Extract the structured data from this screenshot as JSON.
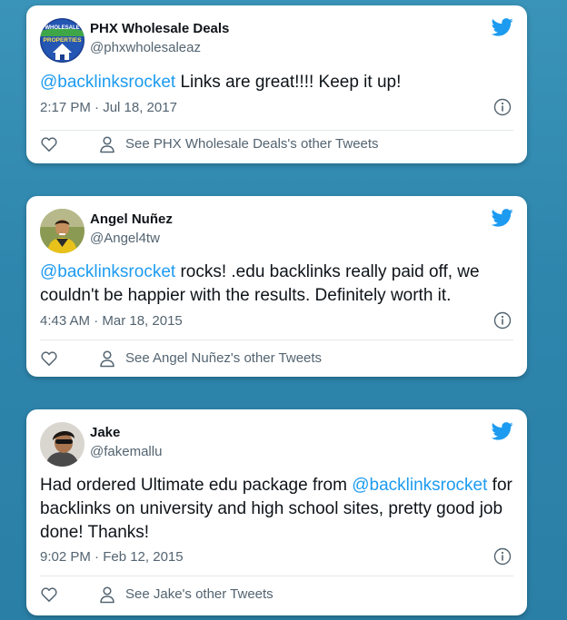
{
  "colors": {
    "background": "#2e86ad",
    "card": "#ffffff",
    "mention": "#1d9bf0",
    "twitter_blue": "#1d9bf0",
    "muted_text": "#536471",
    "primary_text": "#0f1419"
  },
  "tweets": [
    {
      "author_name": "PHX Wholesale Deals",
      "handle": "@phxwholesaleaz",
      "avatar_text": [
        "WHOLESALE",
        "PROPERTIES"
      ],
      "text_parts": [
        {
          "text": "@backlinksrocket",
          "mention": true
        },
        {
          "text": " Links are great!!!! Keep it up!",
          "mention": false
        }
      ],
      "timestamp": "2:17 PM · Jul 18, 2017",
      "see_tweets_label": "See PHX Wholesale Deals's other Tweets",
      "icons": [
        "twitter-bird-icon",
        "info-icon",
        "heart-icon",
        "person-icon"
      ]
    },
    {
      "author_name": "Angel Nuñez",
      "handle": "@Angel4tw",
      "text_parts": [
        {
          "text": "@backlinksrocket",
          "mention": true
        },
        {
          "text": " rocks! .edu backlinks really paid off, we couldn't be happier with the results. Definitely worth it.",
          "mention": false
        }
      ],
      "timestamp": "4:43 AM · Mar 18, 2015",
      "see_tweets_label": "See Angel Nuñez's other Tweets",
      "icons": [
        "twitter-bird-icon",
        "info-icon",
        "heart-icon",
        "person-icon"
      ]
    },
    {
      "author_name": "Jake",
      "handle": "@fakemallu",
      "text_parts": [
        {
          "text": "Had ordered Ultimate edu package from ",
          "mention": false
        },
        {
          "text": "@backlinksrocket",
          "mention": true
        },
        {
          "text": " for backlinks on university and high school sites, pretty good job done! Thanks!",
          "mention": false
        }
      ],
      "timestamp": "9:02 PM · Feb 12, 2015",
      "see_tweets_label": "See Jake's other Tweets",
      "icons": [
        "twitter-bird-icon",
        "info-icon",
        "heart-icon",
        "person-icon"
      ]
    }
  ]
}
